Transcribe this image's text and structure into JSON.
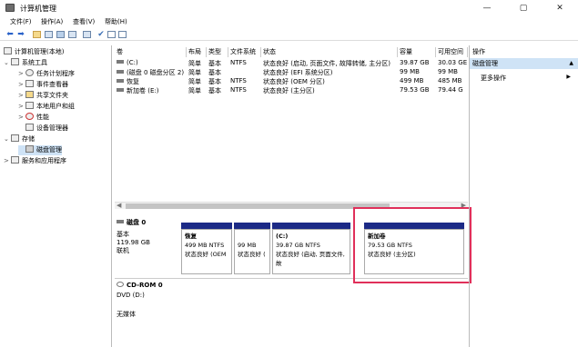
{
  "window": {
    "title": "计算机管理",
    "minimize": "—",
    "maximize": "▢",
    "close": "✕"
  },
  "menu": [
    "文件(F)",
    "操作(A)",
    "查看(V)",
    "帮助(H)"
  ],
  "tree": [
    {
      "label": "计算机管理(本地)",
      "toggle": "",
      "level": 0
    },
    {
      "label": "系统工具",
      "toggle": "⌄",
      "level": 1
    },
    {
      "label": "任务计划程序",
      "toggle": ">",
      "level": 2
    },
    {
      "label": "事件查看器",
      "toggle": ">",
      "level": 2
    },
    {
      "label": "共享文件夹",
      "toggle": ">",
      "level": 2
    },
    {
      "label": "本地用户和组",
      "toggle": ">",
      "level": 2
    },
    {
      "label": "性能",
      "toggle": ">",
      "level": 2
    },
    {
      "label": "设备管理器",
      "toggle": "",
      "level": 2
    },
    {
      "label": "存储",
      "toggle": "⌄",
      "level": 1
    },
    {
      "label": "磁盘管理",
      "toggle": "",
      "level": 2
    },
    {
      "label": "服务和应用程序",
      "toggle": ">",
      "level": 1
    }
  ],
  "table": {
    "headers": [
      "卷",
      "布局",
      "类型",
      "文件系统",
      "状态",
      "容量",
      "可用空间"
    ],
    "rows": [
      [
        "(C:)",
        "简单",
        "基本",
        "NTFS",
        "状态良好 (启动, 页面文件, 故障转储, 主分区)",
        "39.87 GB",
        "30.03 GE"
      ],
      [
        "(磁盘 0 磁盘分区 2)",
        "简单",
        "基本",
        "",
        "状态良好 (EFI 系统分区)",
        "99 MB",
        "99 MB"
      ],
      [
        "恢复",
        "简单",
        "基本",
        "NTFS",
        "状态良好 (OEM 分区)",
        "499 MB",
        "485 MB"
      ],
      [
        "新加卷 (E:)",
        "简单",
        "基本",
        "NTFS",
        "状态良好 (主分区)",
        "79.53 GB",
        "79.44 G"
      ]
    ]
  },
  "disks": {
    "disk0": {
      "name": "磁盘 0",
      "type": "基本",
      "size": "119.98 GB",
      "status": "联机",
      "partitions": [
        {
          "title": "恢复",
          "size": "499 MB NTFS",
          "status": "状态良好 (OEM"
        },
        {
          "title": "",
          "size": "99 MB",
          "status": "状态良好 ("
        },
        {
          "title": "(C:)",
          "size": "39.87 GB NTFS",
          "status": "状态良好 (启动, 页面文件, 故"
        },
        {
          "title": "新加卷",
          "size": "79.53 GB NTFS",
          "status": "状态良好 (主分区)"
        }
      ]
    },
    "cdrom0": {
      "name": "CD-ROM 0",
      "drive": "DVD (D:)",
      "media": "无媒体"
    }
  },
  "actions": {
    "header": "操作",
    "selected": "磁盘管理",
    "more": "更多操作"
  }
}
